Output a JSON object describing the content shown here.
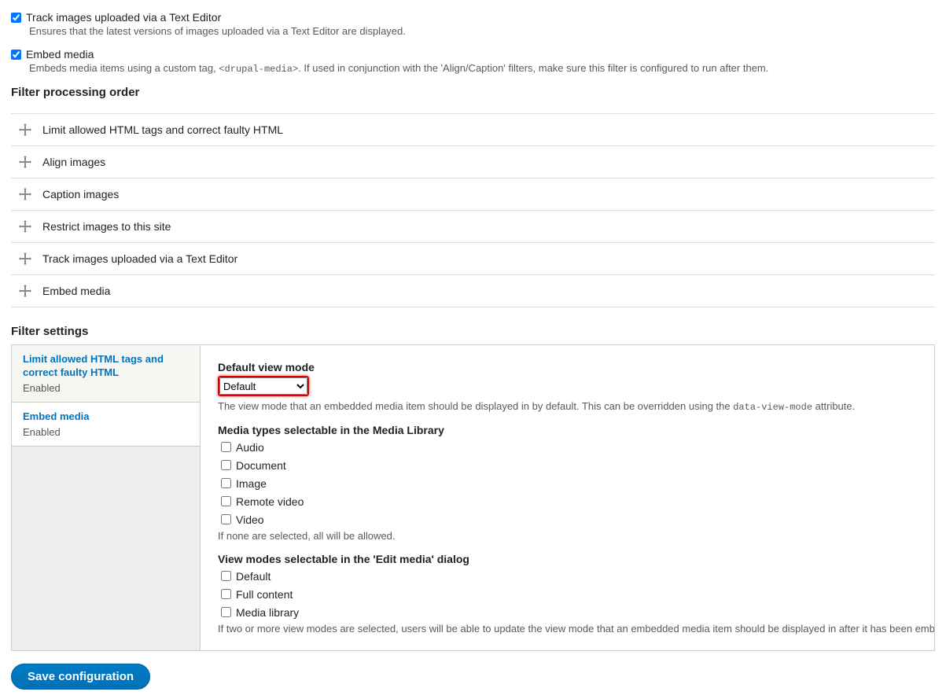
{
  "topFilters": [
    {
      "label": "Track images uploaded via a Text Editor",
      "help": "Ensures that the latest versions of images uploaded via a Text Editor are displayed.",
      "checked": true
    },
    {
      "label": "Embed media",
      "help_pre": "Embeds media items using a custom tag, ",
      "help_code": "<drupal-media>",
      "help_post": ". If used in conjunction with the 'Align/Caption' filters, make sure this filter is configured to run after them.",
      "checked": true
    }
  ],
  "headings": {
    "order": "Filter processing order",
    "settings": "Filter settings"
  },
  "orderItems": [
    "Limit allowed HTML tags and correct faulty HTML",
    "Align images",
    "Caption images",
    "Restrict images to this site",
    "Track images uploaded via a Text Editor",
    "Embed media"
  ],
  "tabs": [
    {
      "title": "Limit allowed HTML tags and correct faulty HTML",
      "sub": "Enabled",
      "active": true
    },
    {
      "title": "Embed media",
      "sub": "Enabled",
      "active": false
    }
  ],
  "panel": {
    "defaultViewMode": {
      "label": "Default view mode",
      "value": "Default",
      "desc_pre": "The view mode that an embedded media item should be displayed in by default. This can be overridden using the ",
      "desc_code": "data-view-mode",
      "desc_post": " attribute."
    },
    "mediaTypes": {
      "label": "Media types selectable in the Media Library",
      "options": [
        "Audio",
        "Document",
        "Image",
        "Remote video",
        "Video"
      ],
      "help": "If none are selected, all will be allowed."
    },
    "viewModes": {
      "label": "View modes selectable in the 'Edit media' dialog",
      "options": [
        "Default",
        "Full content",
        "Media library"
      ],
      "help": "If two or more view modes are selected, users will be able to update the view mode that an embedded media item should be displayed in after it has been embedded. If le"
    }
  },
  "saveLabel": "Save configuration"
}
